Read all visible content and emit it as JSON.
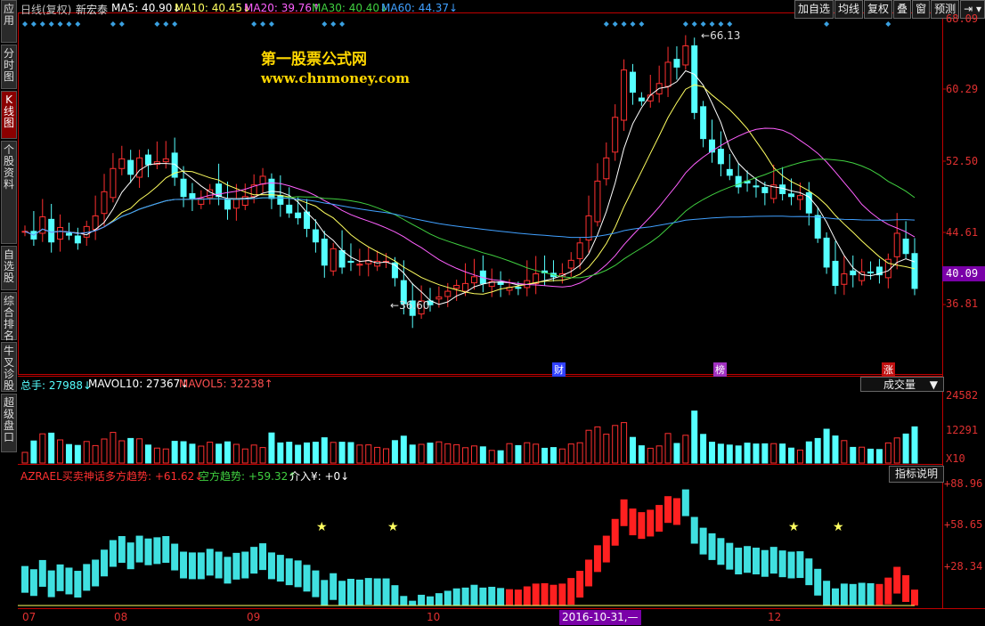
{
  "sidebar": {
    "tabs": [
      {
        "label": "应用",
        "active": false
      },
      {
        "label": "分时图",
        "active": false
      },
      {
        "label": "K线图",
        "active": true
      },
      {
        "label": "个股资料",
        "active": false
      },
      {
        "label": "自选股",
        "active": false
      },
      {
        "label": "综合排名",
        "active": false
      },
      {
        "label": "牛叉诊股",
        "active": false
      },
      {
        "label": "超级盘口",
        "active": false
      }
    ]
  },
  "header": {
    "period": "日线(复权)",
    "stock": "新宏泰",
    "ma5": "MA5: 40.90↓",
    "ma10": "MA10: 40.45↓",
    "ma20": "MA20: 39.76↑",
    "ma30": "MA30: 40.40↓",
    "ma60": "MA60: 44.37↓"
  },
  "toolbar": {
    "buttons": [
      "加自选",
      "均线",
      "复权",
      "叠",
      "窗",
      "预测"
    ]
  },
  "watermark": {
    "line1": "第一股票公式网",
    "line2": "www.chnmoney.com"
  },
  "price_axis": [
    "68.09",
    "60.29",
    "52.50",
    "44.61",
    "36.81"
  ],
  "current_price": "40.09",
  "annotations": {
    "high": "66.13",
    "low": "36.60",
    "cai": "财",
    "bang": "榜",
    "zhang": "涨"
  },
  "volume_header": {
    "total": "总手: 27988↓",
    "mavol10": "MAVOL10: 27367↓",
    "mavol5": "MAVOL5: 32238↑",
    "selector": "成交量"
  },
  "volume_axis": [
    "24582",
    "12291",
    "X10"
  ],
  "indicator_header": {
    "name": "AZRAEL买卖神话",
    "bull": "多方趋势: +61.62↓",
    "bear": "空方趋势: +59.32↑",
    "entry": "介入¥: +0↓",
    "help": "指标说明"
  },
  "indicator_axis": [
    "+88.96",
    "+58.65",
    "+28.34"
  ],
  "x_axis": {
    "labels": [
      "07",
      "08",
      "09",
      "10",
      "11",
      "12"
    ],
    "cursor_date": "2016-10-31,—"
  },
  "colors": {
    "up": "#ff3030",
    "down": "#55ffff",
    "ma5": "#ffffff",
    "ma10": "#ffff60",
    "ma20": "#ff60ff",
    "ma30": "#40d040",
    "ma60": "#40a0ff",
    "axis": "#c00000"
  },
  "chart_data": {
    "type": "candlestick",
    "closes": [
      46,
      45.2,
      47.5,
      44.9,
      46.4,
      45.6,
      44.8,
      46.5,
      47.6,
      50.1,
      52.5,
      53.5,
      51.9,
      53.6,
      52.9,
      53.2,
      53.5,
      51.6,
      49.6,
      49.4,
      49.4,
      50.3,
      49.6,
      48.3,
      49.3,
      49.6,
      50.8,
      51.7,
      49.4,
      48.8,
      47.9,
      47.4,
      46.3,
      44.9,
      42.5,
      44.2,
      42.3,
      42.8,
      42.6,
      43,
      42.9,
      42.9,
      41.2,
      38.5,
      37.3,
      38.8,
      38.4,
      39.2,
      39.8,
      40.4,
      40.6,
      41.3,
      40.6,
      40.8,
      40.5,
      40.2,
      40.1,
      40.9,
      41.6,
      41.7,
      41.3,
      41.6,
      43,
      44.8,
      47.6,
      51.2,
      53.6,
      57.8,
      62.7,
      60.4,
      59.5,
      60.1,
      61.3,
      63.5,
      63,
      65.2,
      58.3,
      55.6,
      54.2,
      53,
      51.8,
      50.6,
      51,
      50.6,
      50,
      50.8,
      49.9,
      49.6,
      49.7,
      47.9,
      45.3,
      42.3,
      40.4,
      41.6,
      41.5,
      41.8,
      41.7,
      41.5,
      43.1,
      45.8,
      43.7,
      40.09
    ]
  }
}
